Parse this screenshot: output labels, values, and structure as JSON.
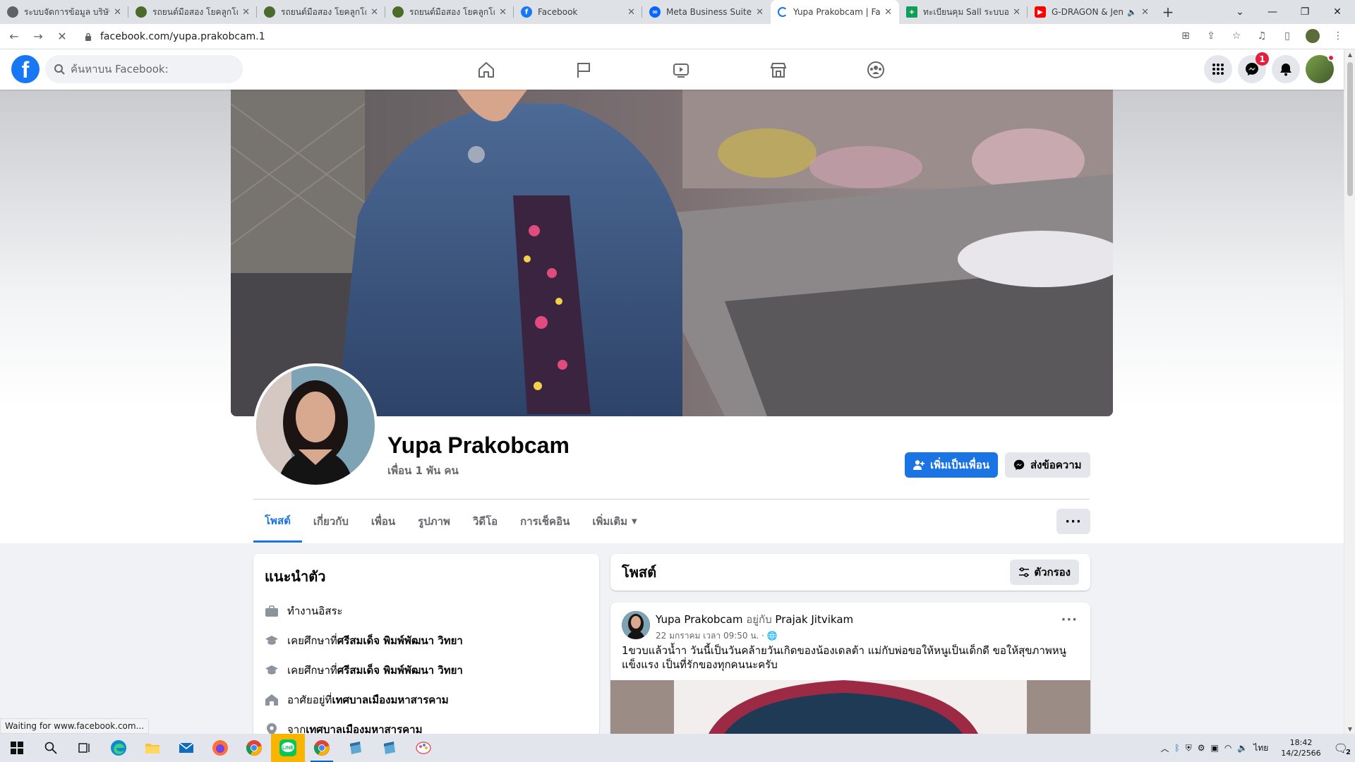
{
  "browser": {
    "tabs": [
      {
        "title": "ระบบจัดการข้อมูล บริษัท โ",
        "favicon_color": "#5f6368"
      },
      {
        "title": "รถยนต์มือสอง โยคลูกโต",
        "favicon_color": "#4a6b2a"
      },
      {
        "title": "รถยนต์มือสอง โยคลูกโต",
        "favicon_color": "#4a6b2a"
      },
      {
        "title": "รถยนต์มือสอง โยคลูกโต",
        "favicon_color": "#4a6b2a"
      },
      {
        "title": "Facebook",
        "favicon_color": "#1877f2"
      },
      {
        "title": "Meta Business Suite",
        "favicon_color": "#0866ff"
      },
      {
        "title": "Yupa Prakobcam | Fac",
        "favicon_color": "#1a73e8",
        "active": true
      },
      {
        "title": "ทะเบียนคุม Sall ระบบออนไ",
        "favicon_color": "#0f9d58"
      },
      {
        "title": "G-DRAGON & Jen",
        "favicon_color": "#ff0000"
      }
    ],
    "url": "facebook.com/yupa.prakobcam.1",
    "status_text": "Waiting for www.facebook.com..."
  },
  "fb": {
    "search_placeholder": "ค้นหาบน Facebook:",
    "messenger_badge": "1",
    "profile": {
      "name": "Yupa Prakobcam",
      "friends": "เพื่อน 1 พัน คน",
      "add_friend": "เพิ่มเป็นเพื่อน",
      "message": "ส่งข้อความ",
      "tabs": [
        "โพสต์",
        "เกี่ยวกับ",
        "เพื่อน",
        "รูปภาพ",
        "วิดีโอ",
        "การเช็คอิน",
        "เพิ่มเติม"
      ],
      "more_dots": "···"
    },
    "intro": {
      "title": "แนะนำตัว",
      "items": [
        {
          "prefix": "ทำงานอิสระ",
          "bold": ""
        },
        {
          "prefix": "เคยศึกษาที่ ",
          "bold": "ศรีสมเด็จ พิมพ์พัฒนา วิทยา"
        },
        {
          "prefix": "เคยศึกษาที่ ",
          "bold": "ศรีสมเด็จ พิมพ์พัฒนา วิทยา"
        },
        {
          "prefix": "อาศัยอยู่ที่ ",
          "bold": "เทศบาลเมืองมหาสารคาม"
        },
        {
          "prefix": "จาก ",
          "bold": "เทศบาลเมืองมหาสารคาม"
        }
      ]
    },
    "posts_title": "โพสต์",
    "filter_label": "ตัวกรอง",
    "post": {
      "author": "Yupa Prakobcam",
      "with_word": " อยู่กับ ",
      "with_name": "Prajak Jitvikam",
      "time": "22 มกราคม เวลา 09:50 น. · ",
      "text": "1ขวบแล้วน้ำา วันนี้เป็นวันคล้ายวันเกิดของน้องเดลต้า แม่กับพ่อขอให้หนูเป็นเด็กดี ขอให้สุขภาพหนูแข็งแรง เป็นที่รักของทุกคนนะครับ",
      "dots": "···"
    }
  },
  "taskbar": {
    "lang": "ไทย",
    "time": "18:42",
    "date": "14/2/2566",
    "notif_count": "2"
  }
}
